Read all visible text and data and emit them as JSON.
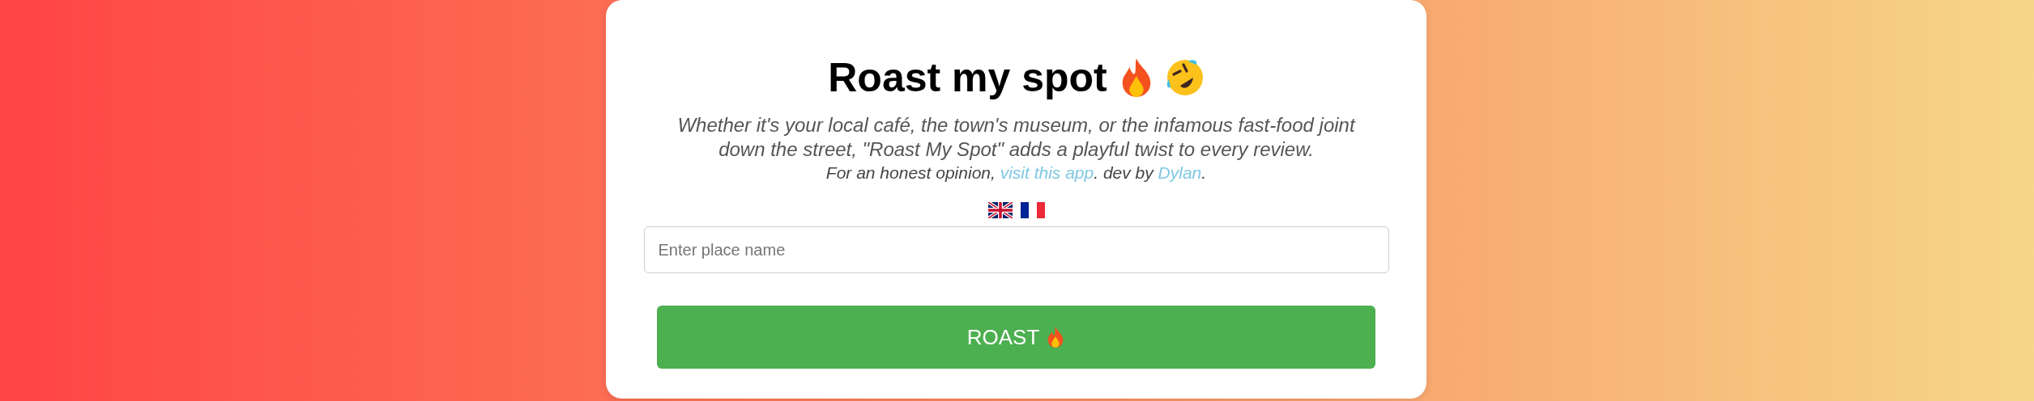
{
  "title": "Roast my spot",
  "subtitle": "Whether it's your local café, the town's museum, or the infamous fast-food joint down the street, \"Roast My Spot\" adds a playful twist to every review.",
  "credit": {
    "before": "For an honest opinion,",
    "link": "visit this app",
    "middle": ". dev by",
    "author": "Dylan",
    "after": "."
  },
  "languages": [
    {
      "kind": "uk"
    },
    {
      "kind": "fr"
    }
  ],
  "search": {
    "placeholder": "Enter place name"
  },
  "button": {
    "label": "ROAST"
  }
}
